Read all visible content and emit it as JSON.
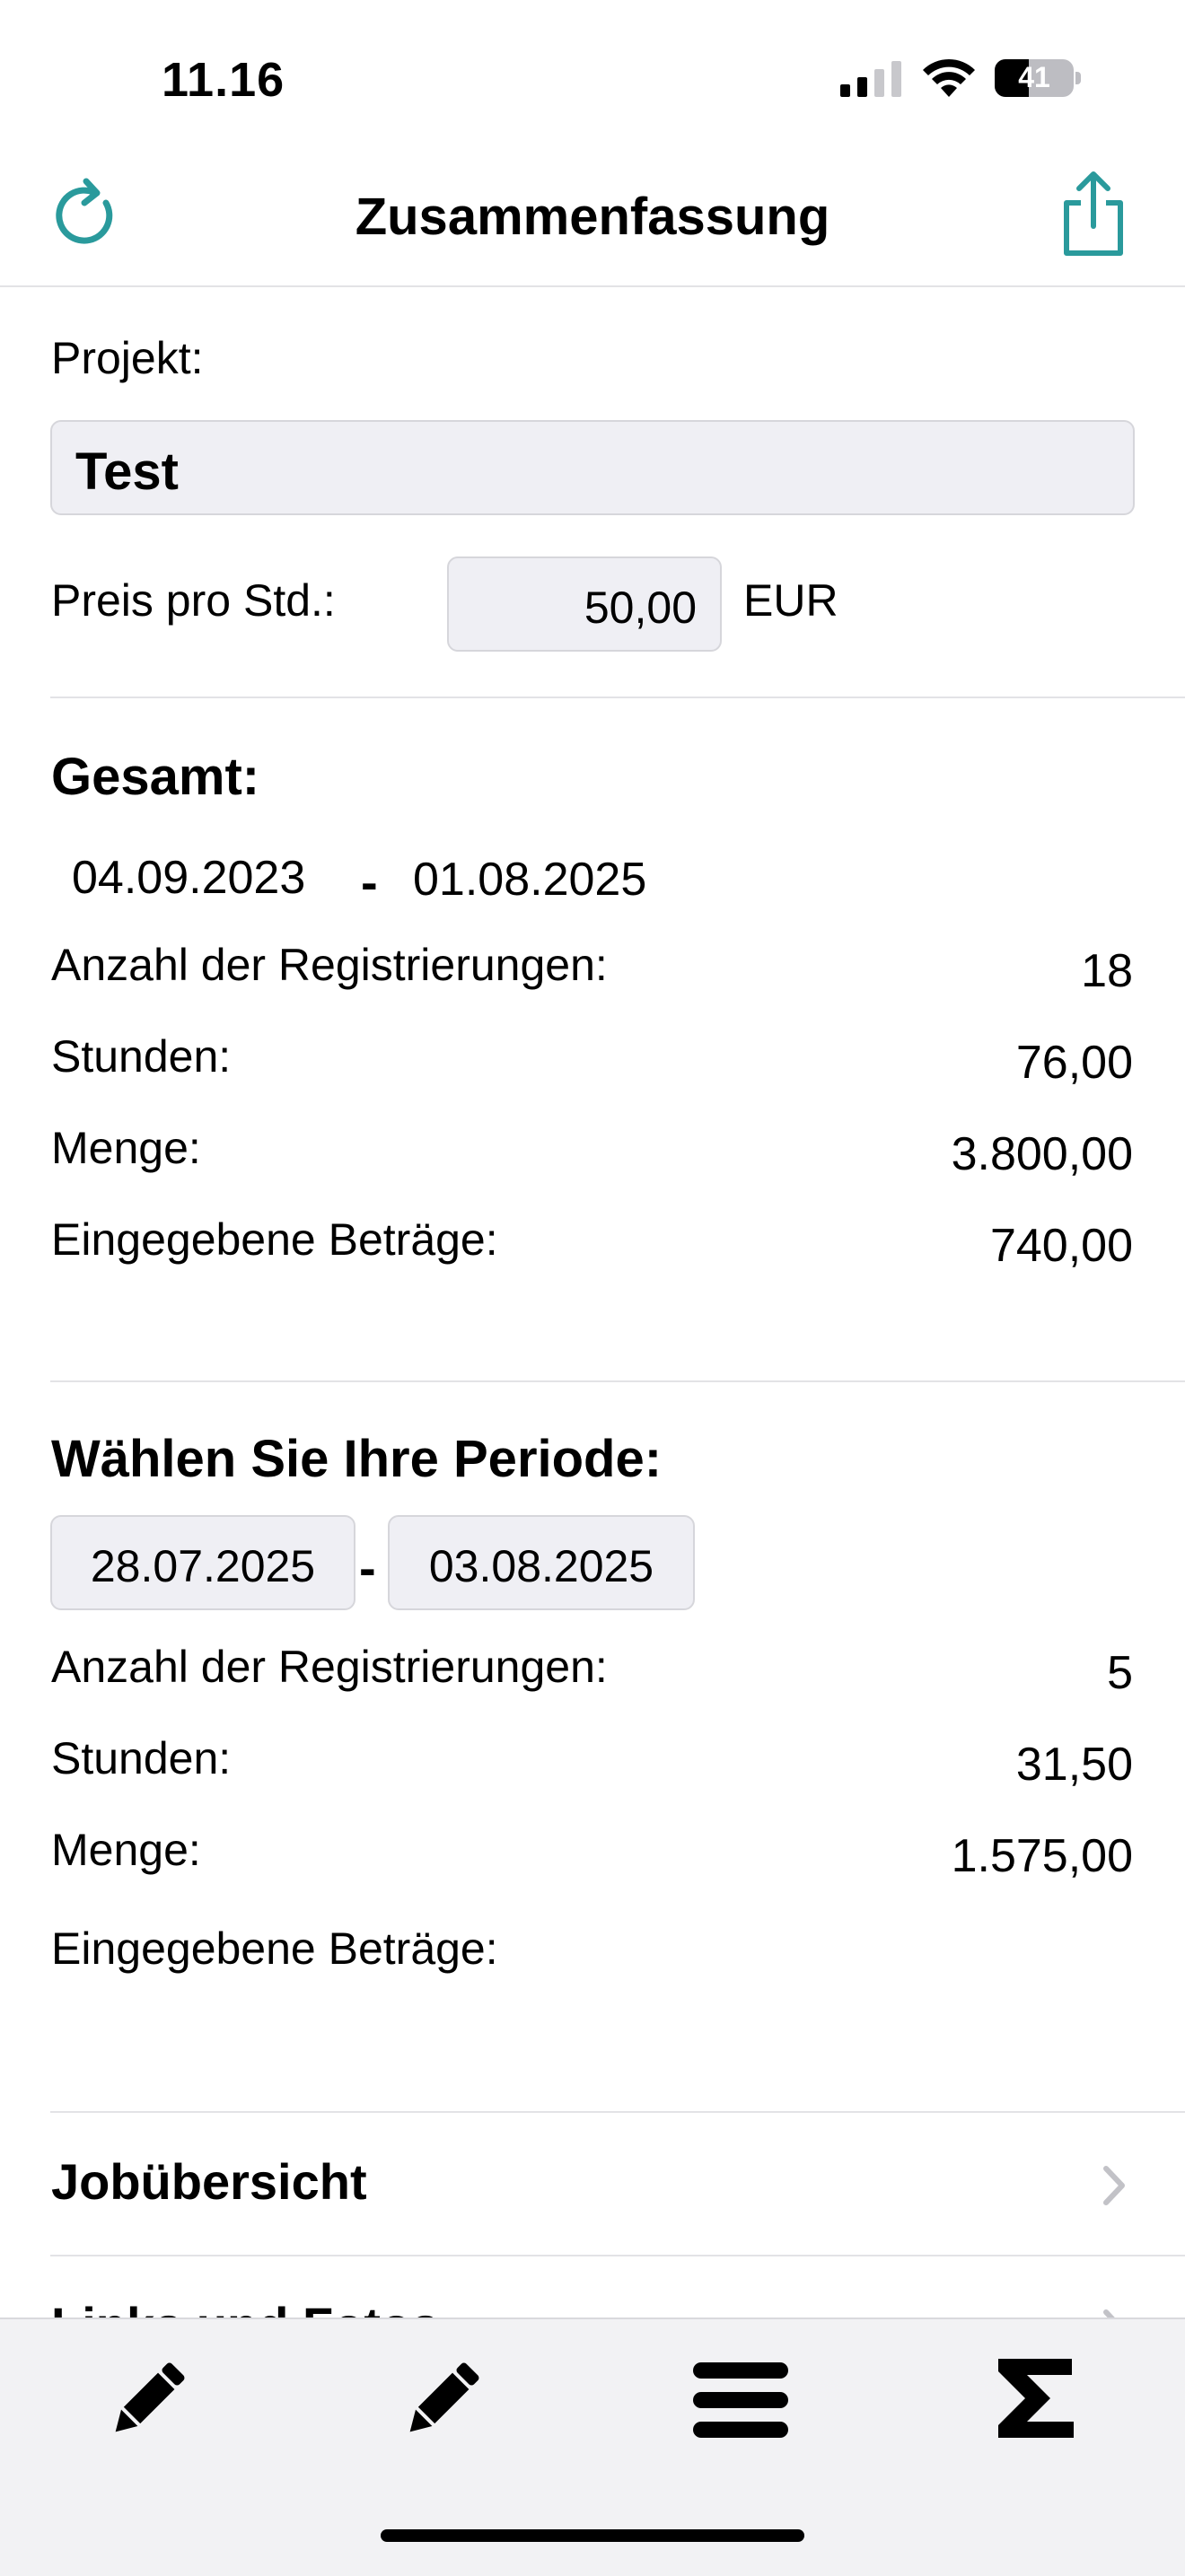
{
  "status_bar": {
    "time": "11.16",
    "battery": "41"
  },
  "header": {
    "title": "Zusammenfassung"
  },
  "project": {
    "label": "Projekt:",
    "value": "Test"
  },
  "price": {
    "label": "Preis pro Std.:",
    "value": "50,00",
    "currency": "EUR"
  },
  "total": {
    "heading": "Gesamt:",
    "date_from": "04.09.2023",
    "date_to": "01.08.2025",
    "separator": "-",
    "rows": [
      {
        "label": "Anzahl der Registrierungen:",
        "value": "18"
      },
      {
        "label": "Stunden:",
        "value": "76,00"
      },
      {
        "label": "Menge:",
        "value": "3.800,00"
      },
      {
        "label": "Eingegebene Beträge:",
        "value": "740,00"
      }
    ]
  },
  "period": {
    "heading": "Wählen Sie Ihre Periode:",
    "date_from": "28.07.2025",
    "date_to": "03.08.2025",
    "separator": "-",
    "rows": [
      {
        "label": "Anzahl der Registrierungen:",
        "value": "5"
      },
      {
        "label": "Stunden:",
        "value": "31,50"
      },
      {
        "label": "Menge:",
        "value": "1.575,00"
      },
      {
        "label": "Eingegebene Beträge:",
        "value": ""
      }
    ]
  },
  "menu": [
    {
      "label": "Jobübersicht"
    },
    {
      "label": "Links und Fotos"
    }
  ],
  "tabs": [
    {
      "icon": "pencil-icon"
    },
    {
      "icon": "pencil-icon"
    },
    {
      "icon": "menu-lines-icon"
    },
    {
      "icon": "sigma-icon"
    }
  ]
}
